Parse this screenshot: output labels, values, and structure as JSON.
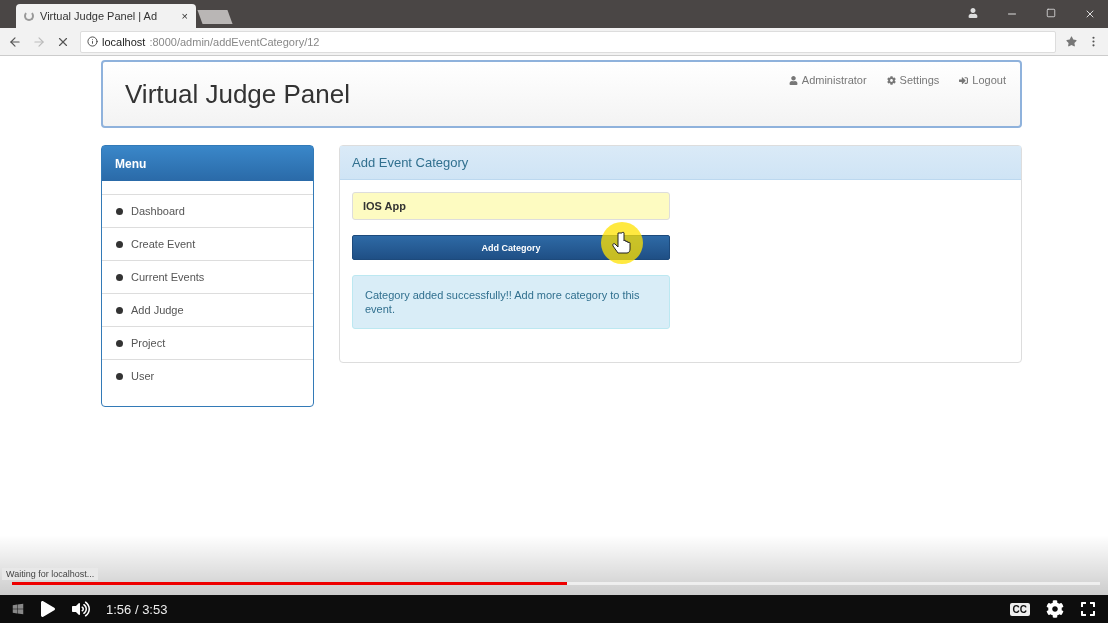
{
  "browser": {
    "tab": {
      "title": "Virtual Judge Panel | Ad",
      "loading": true
    },
    "close": "×",
    "url_host": "localhost",
    "url_path": ":8000/admin/addEventCategory/12"
  },
  "header": {
    "brand": "Virtual Judge Panel",
    "links": [
      {
        "kind": "user",
        "label": "Administrator"
      },
      {
        "kind": "settings",
        "label": "Settings"
      },
      {
        "kind": "logout",
        "label": "Logout"
      }
    ]
  },
  "menu": {
    "title": "Menu",
    "items": [
      {
        "label": "Dashboard"
      },
      {
        "label": "Create Event"
      },
      {
        "label": "Current Events"
      },
      {
        "label": "Add Judge"
      },
      {
        "label": "Project"
      },
      {
        "label": "User"
      }
    ]
  },
  "panel": {
    "title": "Add Event Category",
    "field_value": "IOS App",
    "button": "Add Category",
    "alert": "Category added successfully!! Add more category to this event."
  },
  "status": "Waiting for localhost...",
  "player": {
    "level": 0.51,
    "time": "1:56 / 3:53",
    "playing": false,
    "captions": "CC"
  }
}
